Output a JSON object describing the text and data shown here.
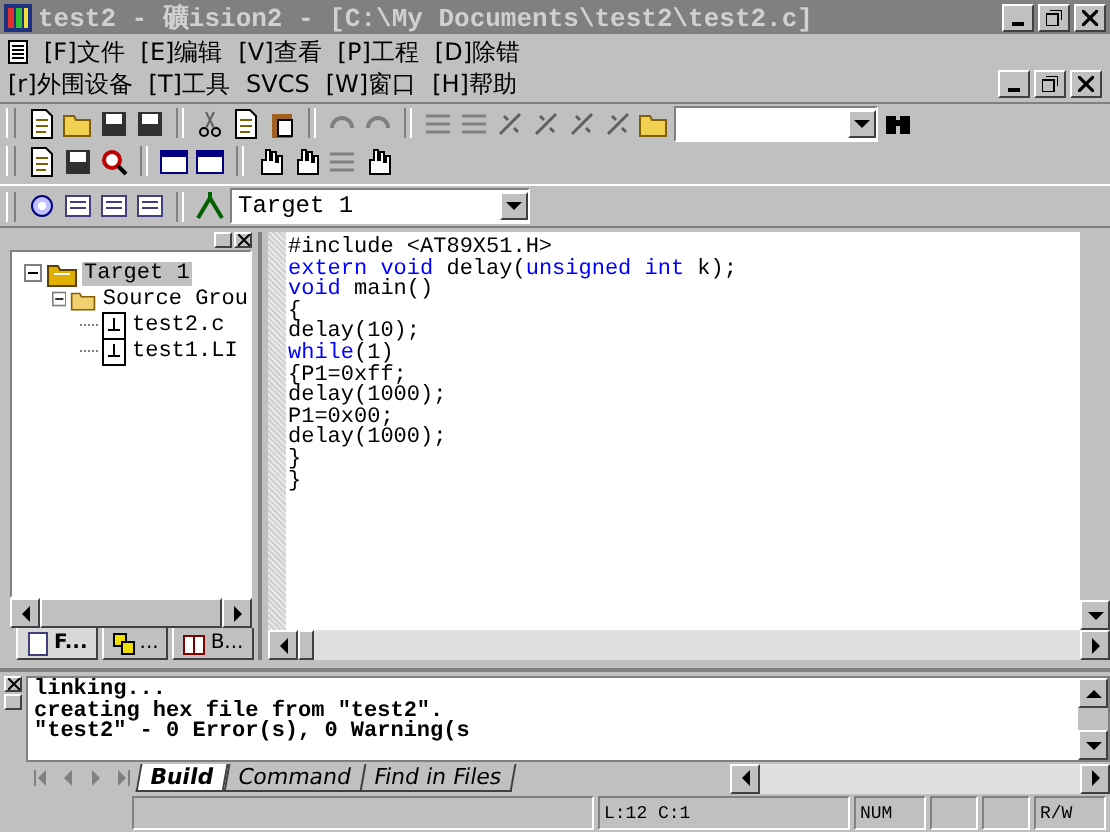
{
  "window": {
    "title": "test2  - 礦ision2 - [C:\\My Documents\\test2\\test2.c]"
  },
  "menu_rows": [
    [
      "[F]文件",
      "[E]编辑",
      "[V]查看",
      "[P]工程",
      "[D]除错"
    ],
    [
      "[r]外围设备",
      "[T]工具",
      "SVCS",
      "[W]窗口",
      "[H]帮助"
    ]
  ],
  "target_combo": {
    "value": "Target 1"
  },
  "project_tree": [
    {
      "label": "Target 1",
      "kind": "target",
      "selected": true,
      "expanded": true,
      "children": [
        {
          "label": "Source Grou",
          "kind": "group",
          "selected": false,
          "expanded": true,
          "children": [
            {
              "label": "test2.c",
              "kind": "file",
              "selected": false
            },
            {
              "label": "test1.LI",
              "kind": "file",
              "selected": false
            }
          ]
        }
      ]
    }
  ],
  "panel_tabs": [
    {
      "label": "F...",
      "selected": true
    },
    {
      "label": "...",
      "selected": false
    },
    {
      "label": "B...",
      "selected": false
    }
  ],
  "code_lines": [
    [
      {
        "text": "#include <AT89X51.H>",
        "kind": "plain"
      }
    ],
    [
      {
        "text": "extern void",
        "kind": "keyword"
      },
      {
        "text": " delay(",
        "kind": "plain"
      },
      {
        "text": "unsigned int",
        "kind": "keyword"
      },
      {
        "text": " k);",
        "kind": "plain"
      }
    ],
    [
      {
        "text": "void",
        "kind": "keyword"
      },
      {
        "text": " main()",
        "kind": "plain"
      }
    ],
    [
      {
        "text": "{",
        "kind": "plain"
      }
    ],
    [
      {
        "text": "delay(10);",
        "kind": "plain"
      }
    ],
    [
      {
        "text": "while",
        "kind": "keyword"
      },
      {
        "text": "(1)",
        "kind": "plain"
      }
    ],
    [
      {
        "text": "{P1=0xff;",
        "kind": "plain"
      }
    ],
    [
      {
        "text": "delay(1000);",
        "kind": "plain"
      }
    ],
    [
      {
        "text": "P1=0x00;",
        "kind": "plain"
      }
    ],
    [
      {
        "text": "delay(1000);",
        "kind": "plain"
      }
    ],
    [
      {
        "text": "}",
        "kind": "plain"
      }
    ],
    [
      {
        "text": "}",
        "kind": "plain"
      }
    ]
  ],
  "output_lines": [
    "linking...",
    "creating hex file from \"test2\".",
    "\"test2\" - 0 Error(s), 0 Warning(s"
  ],
  "output_tabs": [
    {
      "label": "Build",
      "selected": true
    },
    {
      "label": "Command",
      "selected": false
    },
    {
      "label": "Find in Files",
      "selected": false
    }
  ],
  "status_bar": {
    "position": "L:12 C:1",
    "num": "NUM",
    "mode": "R/W"
  }
}
